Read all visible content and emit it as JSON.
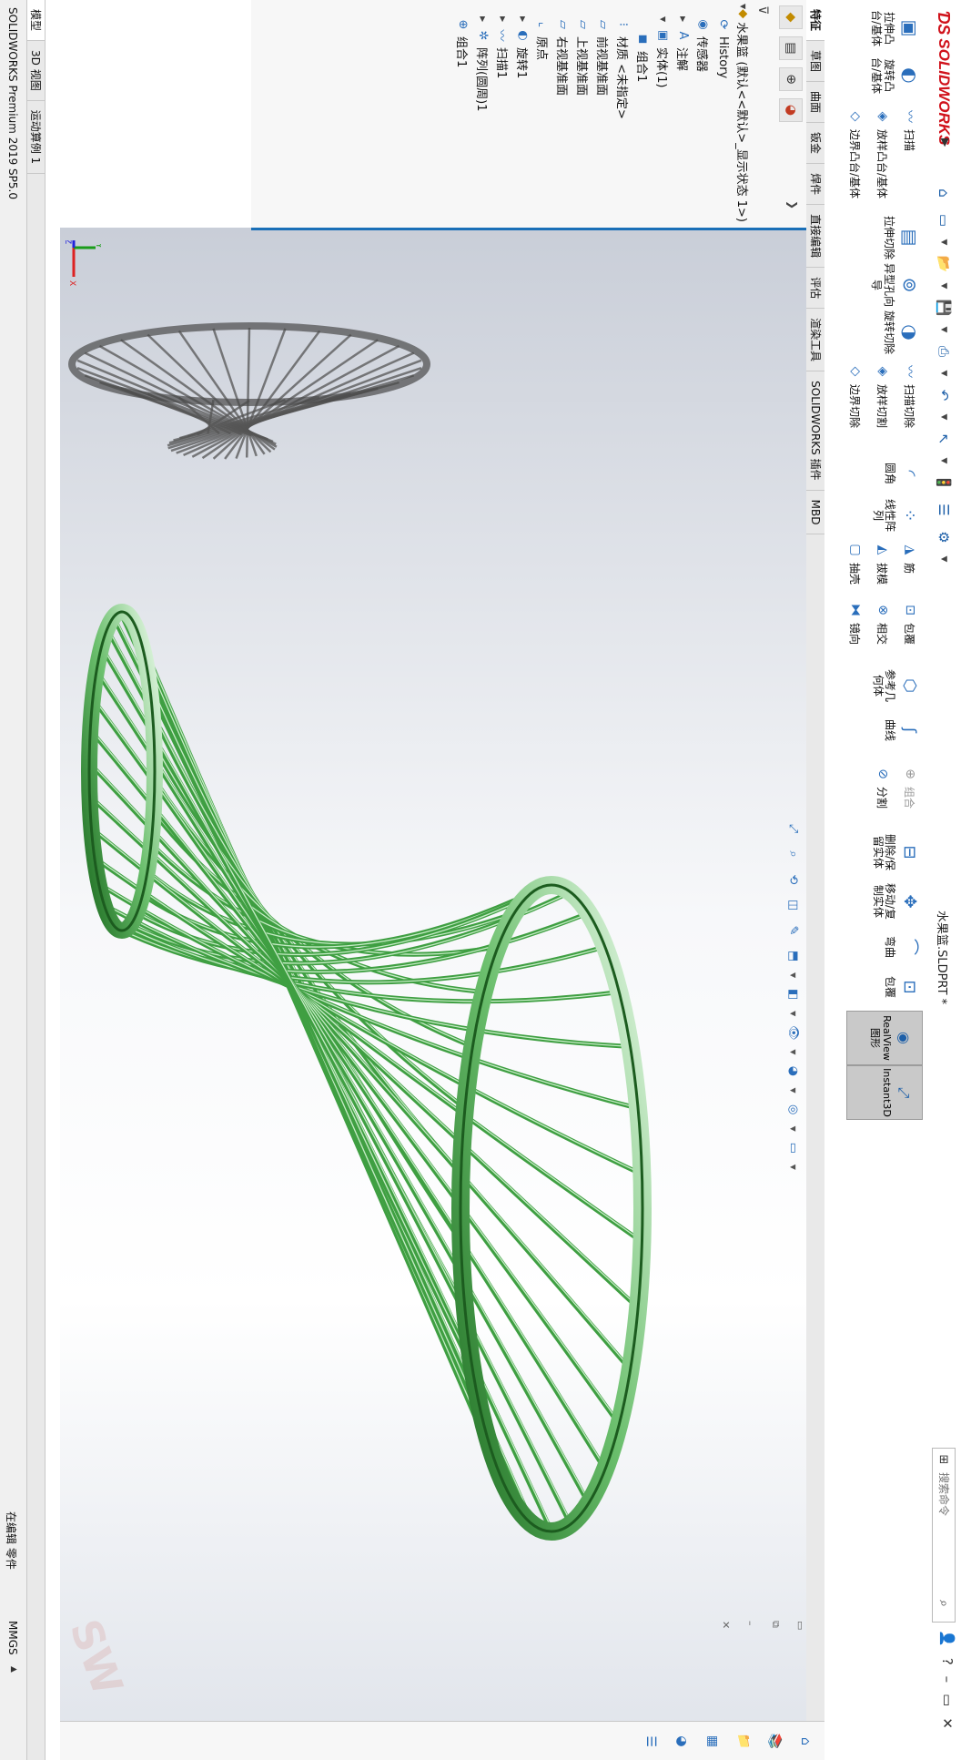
{
  "app": {
    "brand": "SOLIDWORKS",
    "doc_title": "水果篮.SLDPRT *",
    "search_placeholder": "搜索命令"
  },
  "colors": {
    "brand_red": "#d0121b",
    "accent_blue": "#1a6fb7",
    "model_green": "#3f9f42",
    "model_green_light": "#c7ecc7"
  },
  "commands": {
    "extrude_boss": "拉伸凸台/基体",
    "revolve_boss": "旋转凸台/基体",
    "sweep": "扫描",
    "loft": "放样凸台/基体",
    "boundary_boss": "边界凸台/基体",
    "extrude_cut": "拉伸切除",
    "hole_wizard": "异型孔向导",
    "revolve_cut": "旋转切除",
    "swept_cut": "扫描切除",
    "lofted_cut": "放样切割",
    "boundary_cut": "边界切除",
    "fillet": "圆角",
    "linear_pattern": "线性阵列",
    "rib": "筋",
    "draft": "拔模",
    "shell": "抽壳",
    "wrap": "包覆",
    "intersect": "相交",
    "mirror": "镜向",
    "ref_geometry": "参考几何体",
    "curves": "曲线",
    "combine": "组合",
    "split": "分割",
    "delete_body": "删除/保留实体",
    "move_copy": "移动/复制实体",
    "flex": "弯曲",
    "wrap2": "包覆",
    "realview": "RealView 图形",
    "instant3d": "Instant3D"
  },
  "tabs": [
    "特征",
    "草图",
    "曲面",
    "钣金",
    "焊件",
    "直接编辑",
    "评估",
    "渲染工具",
    "SOLIDWORKS 插件",
    "MBD"
  ],
  "tree": [
    {
      "label": "水果篮  (默认<<默认>_显示状态 1>)",
      "icon": "part-icon",
      "level": 0
    },
    {
      "label": "History",
      "icon": "history-icon",
      "level": 1
    },
    {
      "label": "传感器",
      "icon": "sensor-icon",
      "level": 1
    },
    {
      "label": "注解",
      "icon": "annotation-icon",
      "level": 1
    },
    {
      "label": "实体(1)",
      "icon": "solid-bodies-icon",
      "level": 1
    },
    {
      "label": "组合1",
      "icon": "body-icon",
      "level": 2
    },
    {
      "label": "材质 <未指定>",
      "icon": "material-icon",
      "level": 1
    },
    {
      "label": "前视基准面",
      "icon": "plane-icon",
      "level": 1
    },
    {
      "label": "上视基准面",
      "icon": "plane-icon",
      "level": 1
    },
    {
      "label": "右视基准面",
      "icon": "plane-icon",
      "level": 1
    },
    {
      "label": "原点",
      "icon": "origin-icon",
      "level": 1
    },
    {
      "label": "旋转1",
      "icon": "revolve-icon",
      "level": 1
    },
    {
      "label": "扫描1",
      "icon": "sweep-icon",
      "level": 1
    },
    {
      "label": "阵列(圆周)1",
      "icon": "circular-pattern-icon",
      "level": 1
    },
    {
      "label": "组合1",
      "icon": "combine-icon",
      "level": 1
    }
  ],
  "model_tabs": [
    "模型",
    "3D 视图",
    "运动算例 1"
  ],
  "status": {
    "product": "SOLIDWORKS Premium 2019 SP5.0",
    "editing": "在编辑 零件",
    "units": "MMGS"
  },
  "triad": {
    "x": "X",
    "y": "Y",
    "z": "Z"
  }
}
